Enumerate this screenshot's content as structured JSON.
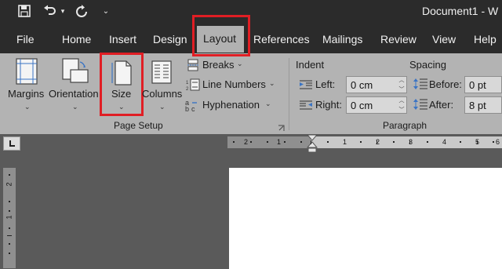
{
  "titlebar": {
    "save_icon": "save-icon",
    "undo_icon": "undo-icon",
    "redo_icon": "redo-icon",
    "customize_icon": "customize-qat-icon",
    "document_title": "Document1  -  W"
  },
  "tabs": [
    "File",
    "Home",
    "Insert",
    "Design",
    "Layout",
    "References",
    "Mailings",
    "Review",
    "View",
    "Help"
  ],
  "active_tab": "Layout",
  "ribbon": {
    "page_setup": {
      "margins": "Margins",
      "orientation": "Orientation",
      "size": "Size",
      "columns": "Columns",
      "breaks": "Breaks",
      "line_numbers": "Line Numbers",
      "hyphenation": "Hyphenation",
      "group_label": "Page Setup"
    },
    "paragraph": {
      "indent_heading": "Indent",
      "spacing_heading": "Spacing",
      "left_label": "Left:",
      "left_value": "0 cm",
      "right_label": "Right:",
      "right_value": "0 cm",
      "before_label": "Before:",
      "before_value": "0 pt",
      "after_label": "After:",
      "after_value": "8 pt",
      "group_label": "Paragraph"
    }
  },
  "ruler": {
    "h_numbers": [
      "2",
      "1",
      "1",
      "2",
      "3",
      "4",
      "5",
      "6"
    ],
    "v_numbers": [
      "2",
      "1"
    ]
  },
  "colors": {
    "highlight": "#e01e24",
    "ribbon_bg": "#b3b3b3",
    "titlebar_bg": "#2b2b2b"
  }
}
